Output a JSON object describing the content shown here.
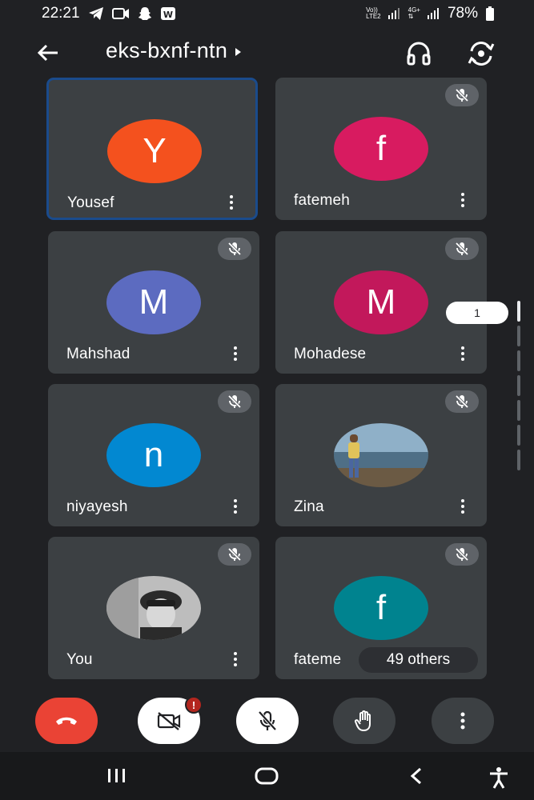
{
  "status_bar": {
    "time": "22:21",
    "network_top": "Vo))",
    "network_bottom": "LTE2",
    "network_type": "4G+",
    "battery": "78%",
    "icons": [
      "telegram-icon",
      "video-icon",
      "snapchat-icon",
      "app-icon",
      "signal-icon",
      "battery-icon"
    ]
  },
  "header": {
    "meeting_code": "eks-bxnf-ntn",
    "icons": [
      "back-arrow-icon",
      "caret-right-icon",
      "headphones-icon",
      "switch-camera-icon"
    ]
  },
  "participants": [
    {
      "name": "Yousef",
      "initial": "Y",
      "color": "#f4511e",
      "muted": false,
      "active": true
    },
    {
      "name": "fatemeh",
      "initial": "f",
      "color": "#d81b60",
      "muted": true,
      "active": false
    },
    {
      "name": "Mahshad",
      "initial": "M",
      "color": "#5c6bc0",
      "muted": true,
      "active": false
    },
    {
      "name": "Mohadese",
      "initial": "M",
      "color": "#c2185b",
      "muted": true,
      "active": false
    },
    {
      "name": "niyayesh",
      "initial": "n",
      "color": "#0288d1",
      "muted": true,
      "active": false
    },
    {
      "name": "Zina",
      "initial": "",
      "color": "#6f8fa8",
      "muted": true,
      "active": false,
      "photo": true
    },
    {
      "name": "You",
      "initial": "",
      "color": "#9e9e9e",
      "muted": true,
      "active": false,
      "photo": true
    },
    {
      "name": "fateme",
      "initial": "f",
      "color": "#00838f",
      "muted": true,
      "active": false
    }
  ],
  "others_label": "49 others",
  "page_indicator": "1",
  "controls": {
    "alert": "!",
    "icons": [
      "hang-up-icon",
      "camera-off-icon",
      "mic-off-icon",
      "raise-hand-icon",
      "more-vert-icon"
    ]
  },
  "nav": {
    "icons": [
      "recent-apps-icon",
      "home-icon",
      "back-icon",
      "accessibility-icon"
    ]
  },
  "colors": {
    "background": "#202124",
    "tile": "#3c4043",
    "hangup": "#ea4335",
    "active_border": "#1a4b8c"
  }
}
